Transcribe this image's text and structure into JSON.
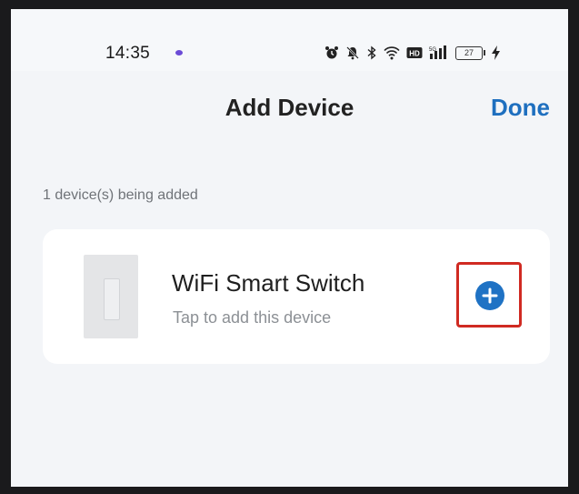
{
  "status_bar": {
    "time": "14:35",
    "battery_level": "27",
    "icons": [
      "notification-dot-icon",
      "alarm-icon",
      "mute-icon",
      "bluetooth-icon",
      "wifi-icon",
      "hd-icon",
      "cellular-signal-icon",
      "battery-icon",
      "charging-icon"
    ]
  },
  "nav": {
    "title": "Add Device",
    "done_label": "Done"
  },
  "adding_status": "1 device(s) being added",
  "devices": [
    {
      "name": "WiFi Smart Switch",
      "subtitle": "Tap to add this device",
      "thumbnail": "wall-switch-image",
      "action_icon": "plus-circle-icon"
    }
  ],
  "colors": {
    "accent": "#1e6fbf",
    "highlight": "#d02a22",
    "background": "#f3f5f8",
    "card": "#ffffff"
  }
}
